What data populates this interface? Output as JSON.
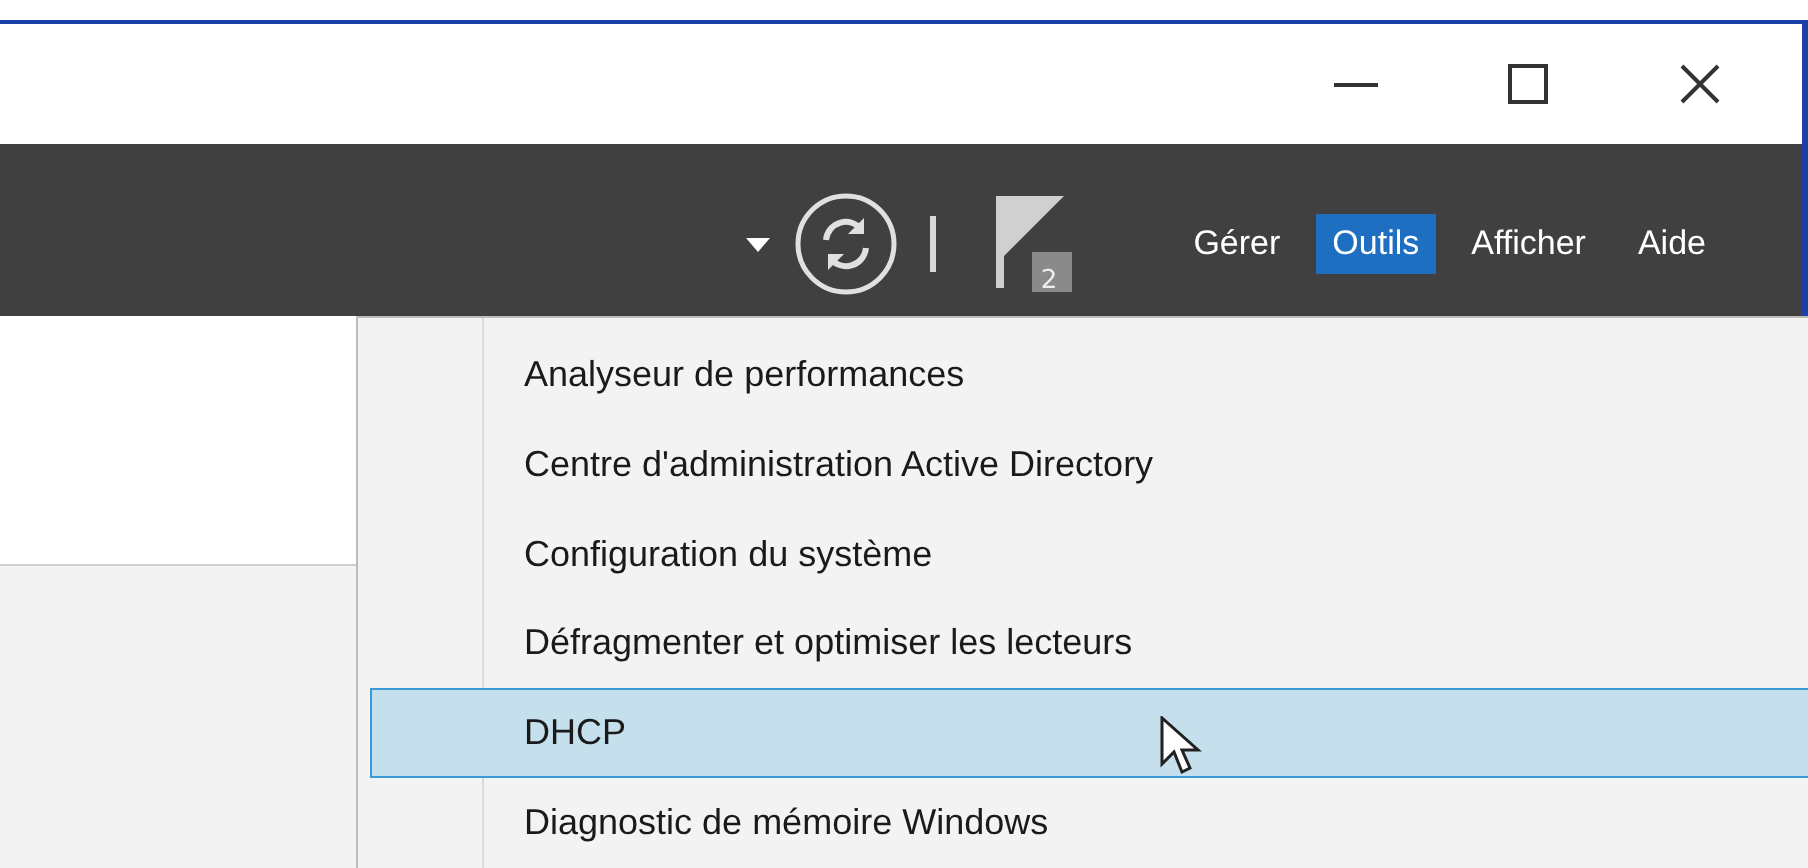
{
  "toolbar": {
    "notification_count": "2",
    "menus": [
      {
        "label": "Gérer",
        "selected": false
      },
      {
        "label": "Outils",
        "selected": true
      },
      {
        "label": "Afficher",
        "selected": false
      },
      {
        "label": "Aide",
        "selected": false
      }
    ]
  },
  "dropdown": {
    "items": [
      {
        "label": "Analyseur de performances",
        "selected": false
      },
      {
        "label": "Centre d'administration Active Directory",
        "selected": false
      },
      {
        "label": "Configuration du système",
        "selected": false
      },
      {
        "label": "Défragmenter et optimiser les lecteurs",
        "selected": false
      },
      {
        "label": "DHCP",
        "selected": true
      },
      {
        "label": "Diagnostic de mémoire Windows",
        "selected": false
      }
    ]
  }
}
